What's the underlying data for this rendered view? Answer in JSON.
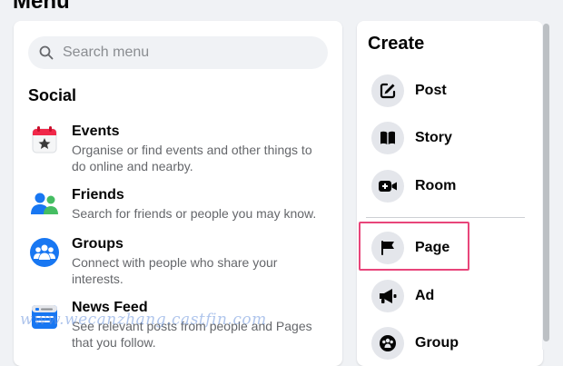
{
  "header": {
    "title": "Menu"
  },
  "search": {
    "placeholder": "Search menu"
  },
  "social": {
    "title": "Social",
    "items": [
      {
        "name": "Events",
        "desc": [
          "Organise or find events and other things to",
          "do online and nearby."
        ],
        "icon": "calendar-icon"
      },
      {
        "name": "Friends",
        "desc": [
          "Search for friends or people you may know."
        ],
        "icon": "friends-icon"
      },
      {
        "name": "Groups",
        "desc": [
          "Connect with people who share your",
          "interests."
        ],
        "icon": "groups-icon"
      },
      {
        "name": "News Feed",
        "desc": [
          "See relevant posts from people and Pages",
          "that you follow."
        ],
        "icon": "news-feed-icon"
      }
    ]
  },
  "create": {
    "title": "Create",
    "items": [
      {
        "label": "Post",
        "icon": "edit-icon"
      },
      {
        "label": "Story",
        "icon": "book-icon"
      },
      {
        "label": "Room",
        "icon": "video-camera-icon"
      },
      {
        "label": "Page",
        "icon": "flag-icon"
      },
      {
        "label": "Ad",
        "icon": "megaphone-icon"
      },
      {
        "label": "Group",
        "icon": "group-icon"
      }
    ]
  },
  "watermark": "www.wecanzhang.castfin.com",
  "colors": {
    "highlight": "#e8457a",
    "accent_blue": "#1877f2",
    "panel": "#ffffff",
    "background": "#f0f2f5"
  }
}
